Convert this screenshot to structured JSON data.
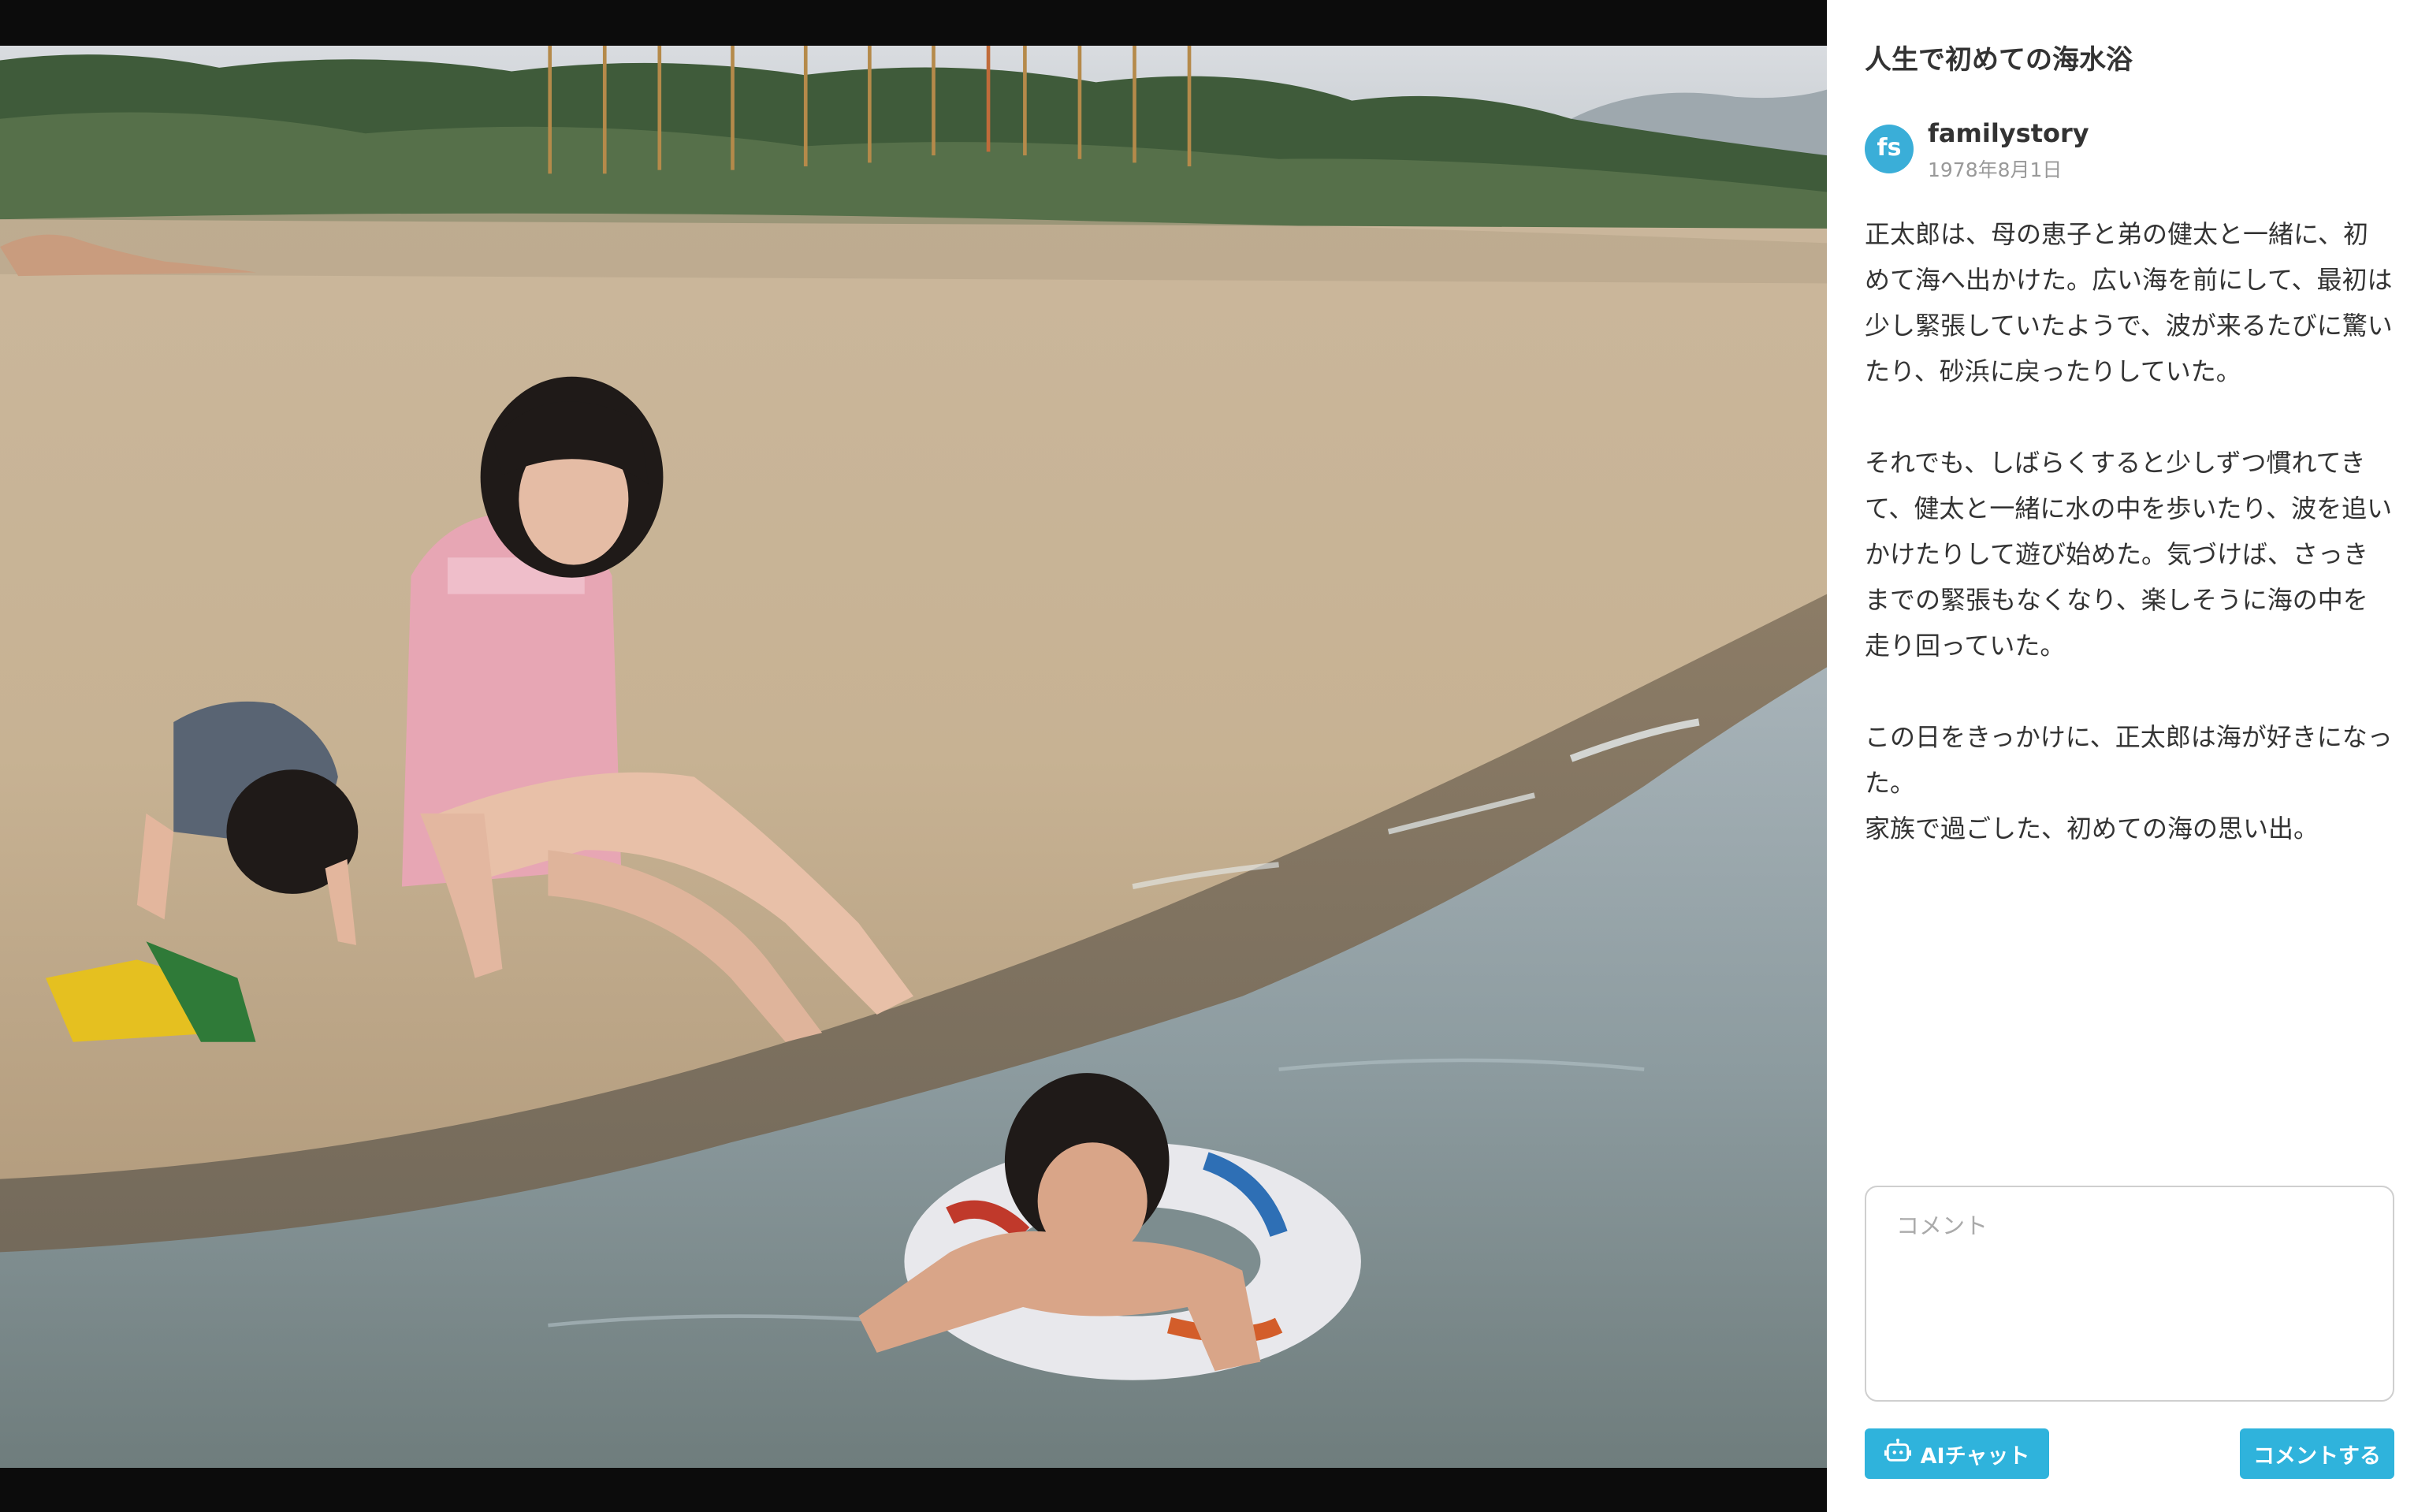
{
  "post": {
    "title": "人生で初めての海水浴",
    "author": {
      "name": "familystory",
      "avatar_text": "fs",
      "date": "1978年8月1日"
    },
    "paragraphs": [
      "正太郎は、母の恵子と弟の健太と一緒に、初めて海へ出かけた。広い海を前にして、最初は少し緊張していたようで、波が来るたびに驚いたり、砂浜に戻ったりしていた。",
      "それでも、しばらくすると少しずつ慣れてきて、健太と一緒に水の中を歩いたり、波を追いかけたりして遊び始めた。気づけば、さっきまでの緊張もなくなり、楽しそうに海の中を走り回っていた。",
      "この日をきっかけに、正太郎は海が好きになった。\n家族で過ごした、初めての海の思い出。"
    ]
  },
  "comment": {
    "placeholder": "コメント",
    "value": ""
  },
  "actions": {
    "ai_chat_label": "AIチャット",
    "submit_label": "コメントする"
  },
  "colors": {
    "accent": "#2fb3dc",
    "panel_background": "#ffffff",
    "viewer_background": "#0c0c0c"
  },
  "icons": {
    "ai_chat": "robot-icon"
  }
}
